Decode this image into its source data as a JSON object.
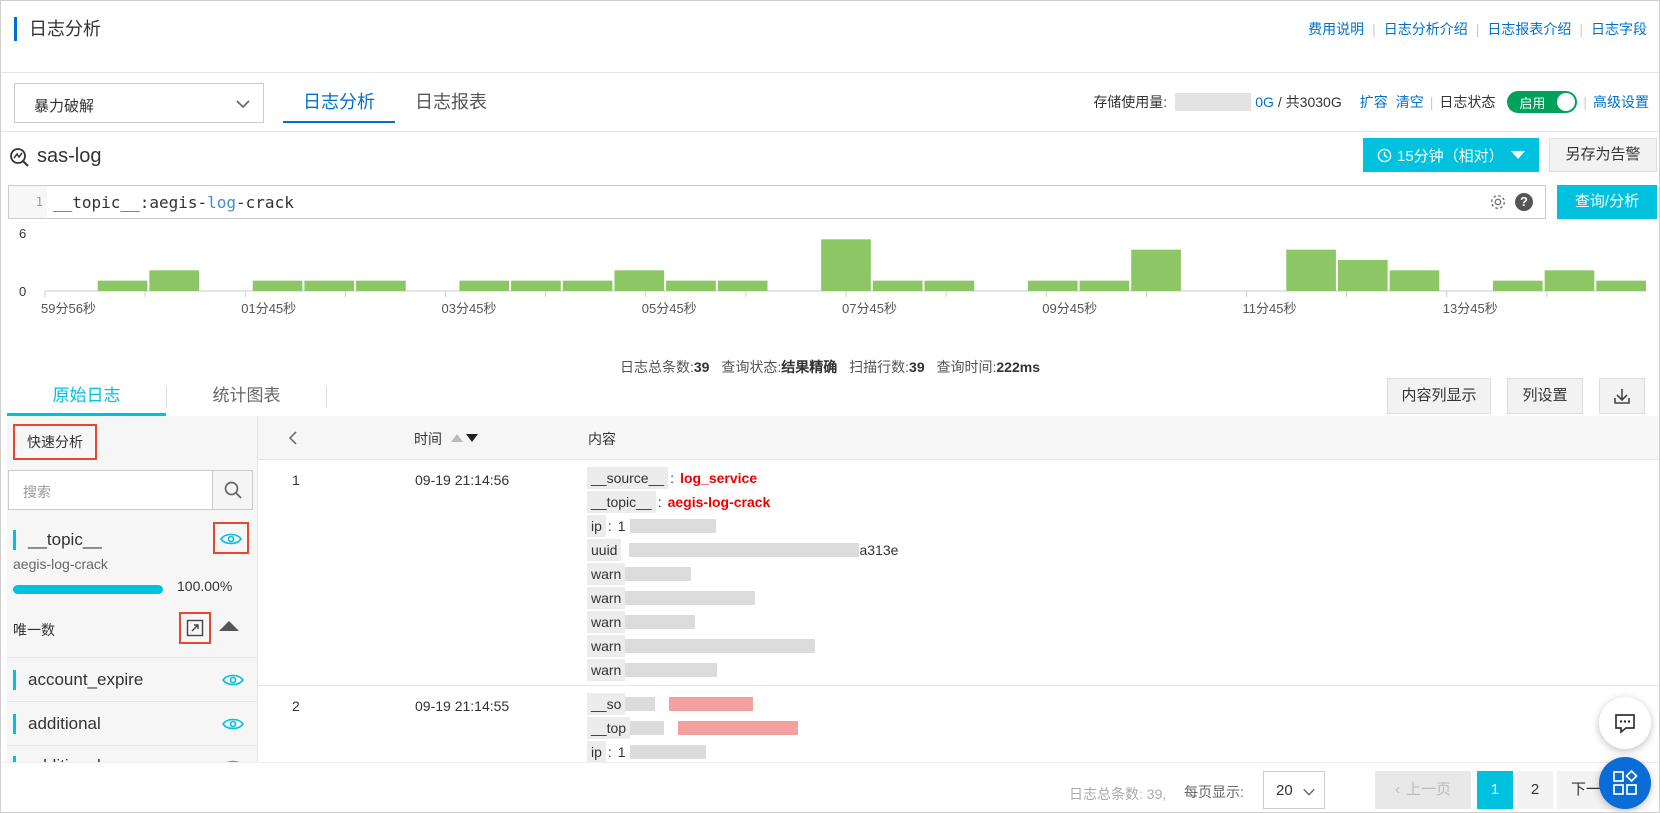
{
  "header": {
    "title": "日志分析",
    "links": [
      "费用说明",
      "日志分析介绍",
      "日志报表介绍",
      "日志字段"
    ]
  },
  "toolbar": {
    "select_value": "暴力破解",
    "tabs": [
      {
        "label": "日志分析",
        "active": true
      },
      {
        "label": "日志报表",
        "active": false
      }
    ],
    "storage_label": "存储使用量:",
    "storage_used": "0G",
    "storage_total": "/ 共3030G",
    "expand": "扩容",
    "clear": "清空",
    "log_status_label": "日志状态",
    "toggle_label": "启用",
    "advanced": "高级设置"
  },
  "logstore": {
    "name": "sas-log",
    "time_range": "15分钟（相对）",
    "save_alert": "另存为告警",
    "query_button": "查询/分析",
    "line_number": "1",
    "query_prefix": "__topic__:aegis-",
    "query_kw": "log",
    "query_suffix": "-crack",
    "help": "?"
  },
  "chart_data": {
    "type": "bar",
    "ylim": [
      0,
      6
    ],
    "yticks": [
      "6",
      "0"
    ],
    "xtick_labels": [
      "59分56秒",
      "01分45秒",
      "03分45秒",
      "05分45秒",
      "07分45秒",
      "09分45秒",
      "11分45秒",
      "13分45秒"
    ],
    "values": [
      0,
      1,
      2,
      0,
      1,
      1,
      1,
      0,
      1,
      1,
      1,
      2,
      1,
      1,
      0,
      5,
      1,
      1,
      0,
      1,
      1,
      4,
      0,
      0,
      4,
      3,
      2,
      0,
      1,
      2,
      1
    ]
  },
  "summary": {
    "total_label": "日志总条数:",
    "total": "39",
    "status_label": "查询状态:",
    "status": "结果精确",
    "scan_label": "扫描行数:",
    "scan": "39",
    "time_label": "查询时间:",
    "time": "222ms"
  },
  "subtabs": [
    {
      "label": "原始日志",
      "active": true
    },
    {
      "label": "统计图表",
      "active": false
    }
  ],
  "actions": {
    "content_display": "内容列显示",
    "column_settings": "列设置"
  },
  "sidebar": {
    "quick_analysis": "快速分析",
    "search_placeholder": "搜索",
    "topic_field": "__topic__",
    "topic_value": "aegis-log-crack",
    "topic_percent": 1.0,
    "topic_percent_label": "100.00%",
    "unique_label": "唯一数",
    "fields": [
      "account_expire",
      "additional",
      "additional"
    ]
  },
  "table": {
    "time_header": "时间",
    "content_header": "内容",
    "rows": [
      {
        "num": "1",
        "time": "09-19 21:14:56",
        "kv": [
          {
            "k": "__source__",
            "v": "log_service",
            "red": true
          },
          {
            "k": "__topic__",
            "v": "aegis-log-crack",
            "red": true
          },
          {
            "k": "ip",
            "v": "1"
          },
          {
            "k": "uuid",
            "v": "a313e"
          },
          {
            "k": "warn",
            "v": ""
          },
          {
            "k": "warn",
            "v": ""
          },
          {
            "k": "warn",
            "v": ""
          },
          {
            "k": "warn",
            "v": ""
          },
          {
            "k": "warn",
            "v": ""
          }
        ]
      },
      {
        "num": "2",
        "time": "09-19 21:14:55",
        "kv": [
          {
            "k": "__so",
            "v": ""
          },
          {
            "k": "__top",
            "v": ""
          },
          {
            "k": "ip",
            "v": "1"
          }
        ]
      }
    ]
  },
  "pagination": {
    "count_text": "日志总条数: 39,",
    "per_page_label": "每页显示:",
    "per_page": "20",
    "prev": "上一页",
    "page1": "1",
    "page2": "2",
    "next": "下一"
  }
}
